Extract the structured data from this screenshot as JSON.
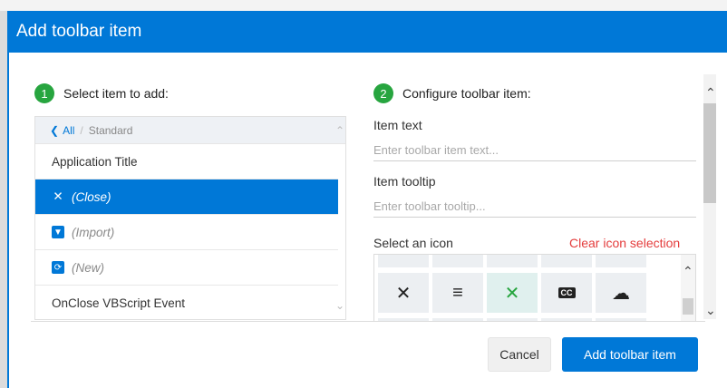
{
  "dialog": {
    "title": "Add toolbar item"
  },
  "step1": {
    "number": "1",
    "label": "Select item to add:"
  },
  "step2": {
    "number": "2",
    "label": "Configure toolbar item:"
  },
  "breadcrumb": {
    "back_icon": "chevron-left-icon",
    "all": "All",
    "separator": "/",
    "current": "Standard"
  },
  "list": {
    "items": [
      {
        "label": "Application Title",
        "icon": null,
        "selected": false
      },
      {
        "label": "(Close)",
        "icon": "close-icon",
        "selected": true
      },
      {
        "label": "(Import)",
        "icon": "import-icon",
        "selected": false
      },
      {
        "label": "(New)",
        "icon": "new-document-icon",
        "selected": false
      },
      {
        "label": "OnClose VBScript Event",
        "icon": null,
        "selected": false
      }
    ]
  },
  "config": {
    "item_text_label": "Item text",
    "item_text_placeholder": "Enter toolbar item text...",
    "item_tooltip_label": "Item tooltip",
    "item_tooltip_placeholder": "Enter toolbar tooltip...",
    "select_icon_label": "Select an icon",
    "clear_icon_label": "Clear icon selection"
  },
  "icons": {
    "visible_row": [
      "close-icon",
      "align-text-icon",
      "close-icon-selected",
      "closed-captions-icon",
      "cloud-icon"
    ]
  },
  "buttons": {
    "cancel": "Cancel",
    "add": "Add toolbar item"
  },
  "colors": {
    "accent": "#0078d7",
    "step_badge": "#27a53f",
    "clear_link": "#e43c3c"
  }
}
